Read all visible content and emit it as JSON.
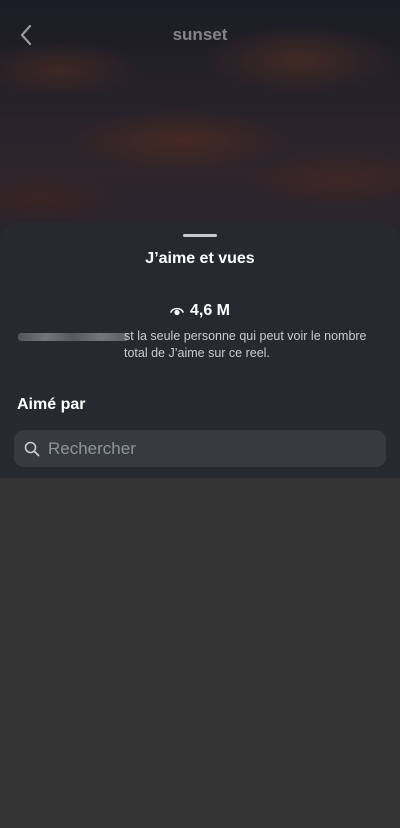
{
  "header": {
    "title": "sunset"
  },
  "sheet": {
    "title": "J’aime et vues",
    "views_count": "4,6 M",
    "info_text": "st la seule personne qui peut voir le nombre total de J’aime sur ce reel.",
    "liked_by_label": "Aimé par",
    "search": {
      "placeholder": "Rechercher",
      "value": ""
    }
  },
  "icons": {
    "back": "chevron-left-icon",
    "views": "eye-icon",
    "search": "search-icon"
  },
  "colors": {
    "sheet_background": "#262a2f",
    "search_background": "#363b42",
    "page_background": "#333333"
  }
}
